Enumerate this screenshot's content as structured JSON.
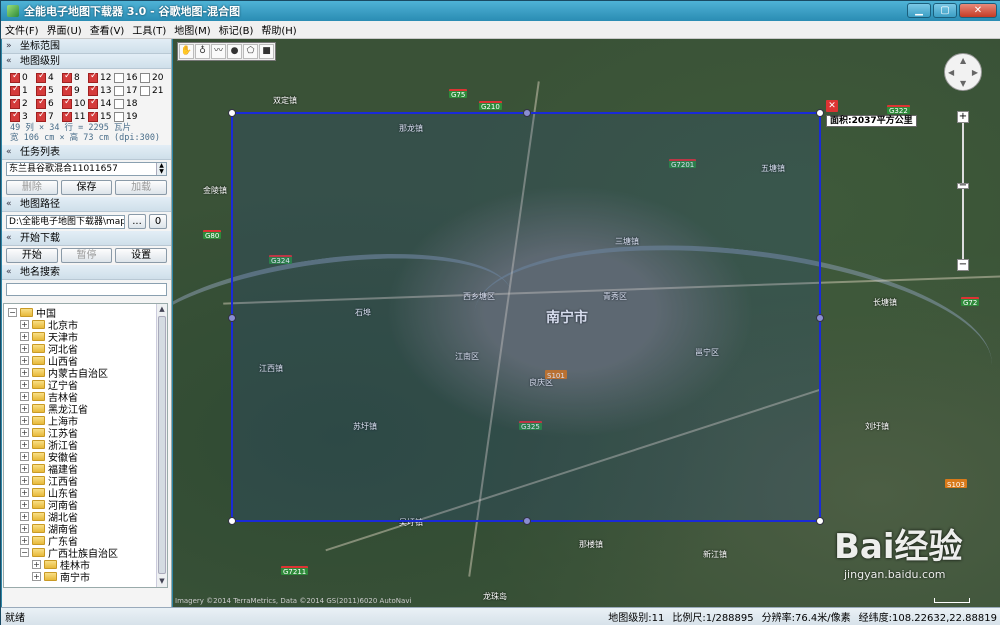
{
  "window": {
    "title": "全能电子地图下载器 3.0 - 谷歌地图-混合图"
  },
  "menu": [
    "文件(F)",
    "界面(U)",
    "查看(V)",
    "工具(T)",
    "地图(M)",
    "标记(B)",
    "帮助(H)"
  ],
  "sections": {
    "coord_range": "坐标范围",
    "map_levels": "地图级别",
    "task_list": "任务列表",
    "map_path": "地图路径",
    "start_download": "开始下载",
    "place_search": "地名搜索"
  },
  "levels": [
    {
      "label": "0",
      "checked": true
    },
    {
      "label": "4",
      "checked": true
    },
    {
      "label": "8",
      "checked": true
    },
    {
      "label": "12",
      "checked": true
    },
    {
      "label": "16",
      "checked": false
    },
    {
      "label": "20",
      "checked": false
    },
    {
      "label": "1",
      "checked": true
    },
    {
      "label": "5",
      "checked": true
    },
    {
      "label": "9",
      "checked": true
    },
    {
      "label": "13",
      "checked": true
    },
    {
      "label": "17",
      "checked": false
    },
    {
      "label": "21",
      "checked": false
    },
    {
      "label": "2",
      "checked": true
    },
    {
      "label": "6",
      "checked": true
    },
    {
      "label": "10",
      "checked": true
    },
    {
      "label": "14",
      "checked": true
    },
    {
      "label": "18",
      "checked": false
    },
    {
      "label": "",
      "checked": null
    },
    {
      "label": "3",
      "checked": true
    },
    {
      "label": "7",
      "checked": true
    },
    {
      "label": "11",
      "checked": true
    },
    {
      "label": "15",
      "checked": true
    },
    {
      "label": "19",
      "checked": false
    },
    {
      "label": "",
      "checked": null
    }
  ],
  "stats": {
    "line1": "49 列 × 34 行 = 2295 瓦片",
    "line2": "宽 106 cm × 高 73 cm (dpi:300)"
  },
  "task": {
    "value": "东兰县谷歌混合11011657",
    "delete": "删除",
    "save": "保存",
    "load": "加载"
  },
  "path": {
    "value": "D:\\全能电子地图下载器\\map",
    "browse": "...",
    "open": "0"
  },
  "download": {
    "start": "开始",
    "pause": "暂停",
    "settings": "设置"
  },
  "tree": [
    {
      "label": "中国",
      "depth": 0,
      "exp": "−"
    },
    {
      "label": "北京市",
      "depth": 1,
      "exp": "+"
    },
    {
      "label": "天津市",
      "depth": 1,
      "exp": "+"
    },
    {
      "label": "河北省",
      "depth": 1,
      "exp": "+"
    },
    {
      "label": "山西省",
      "depth": 1,
      "exp": "+"
    },
    {
      "label": "内蒙古自治区",
      "depth": 1,
      "exp": "+"
    },
    {
      "label": "辽宁省",
      "depth": 1,
      "exp": "+"
    },
    {
      "label": "吉林省",
      "depth": 1,
      "exp": "+"
    },
    {
      "label": "黑龙江省",
      "depth": 1,
      "exp": "+"
    },
    {
      "label": "上海市",
      "depth": 1,
      "exp": "+"
    },
    {
      "label": "江苏省",
      "depth": 1,
      "exp": "+"
    },
    {
      "label": "浙江省",
      "depth": 1,
      "exp": "+"
    },
    {
      "label": "安徽省",
      "depth": 1,
      "exp": "+"
    },
    {
      "label": "福建省",
      "depth": 1,
      "exp": "+"
    },
    {
      "label": "江西省",
      "depth": 1,
      "exp": "+"
    },
    {
      "label": "山东省",
      "depth": 1,
      "exp": "+"
    },
    {
      "label": "河南省",
      "depth": 1,
      "exp": "+"
    },
    {
      "label": "湖北省",
      "depth": 1,
      "exp": "+"
    },
    {
      "label": "湖南省",
      "depth": 1,
      "exp": "+"
    },
    {
      "label": "广东省",
      "depth": 1,
      "exp": "+"
    },
    {
      "label": "广西壮族自治区",
      "depth": 1,
      "exp": "−"
    },
    {
      "label": "桂林市",
      "depth": 2,
      "exp": "+"
    },
    {
      "label": "南宁市",
      "depth": 2,
      "exp": "+"
    }
  ],
  "map": {
    "area_label": "面积:2037平方公里",
    "attribution": "Imagery ©2014 TerraMetrics, Data ©2014 GS(2011)6020 AutoNavi",
    "scale_text": "5公里",
    "city_big": "南宁市",
    "places": [
      "双定镇",
      "石埠",
      "那龙镇",
      "金陵镇",
      "五塘镇",
      "三塘镇",
      "长塘镇",
      "江西镇",
      "吴圩镇",
      "苏圩镇",
      "那楼镇",
      "新江镇",
      "龙珠岛",
      "刘圩镇",
      "邕宁区",
      "青秀区",
      "良庆区",
      "江南区",
      "西乡塘区"
    ],
    "highways": [
      "G75",
      "G210",
      "G322",
      "G7201",
      "G80",
      "G324",
      "G72",
      "S101",
      "S103",
      "G325",
      "G7211"
    ]
  },
  "watermark": {
    "logo": "Bai经验",
    "url": "jingyan.baidu.com"
  },
  "status": {
    "left": "就绪",
    "level": "地图级别:11",
    "scale": "比例尺:1/288895",
    "resolution": "分辨率:76.4米/像素",
    "coords": "经纬度:108.22632,22.88819"
  },
  "colors": {
    "selection": "#1a2ad8",
    "titlebar": "#2a8cb3",
    "checked": "#d43b3b"
  }
}
